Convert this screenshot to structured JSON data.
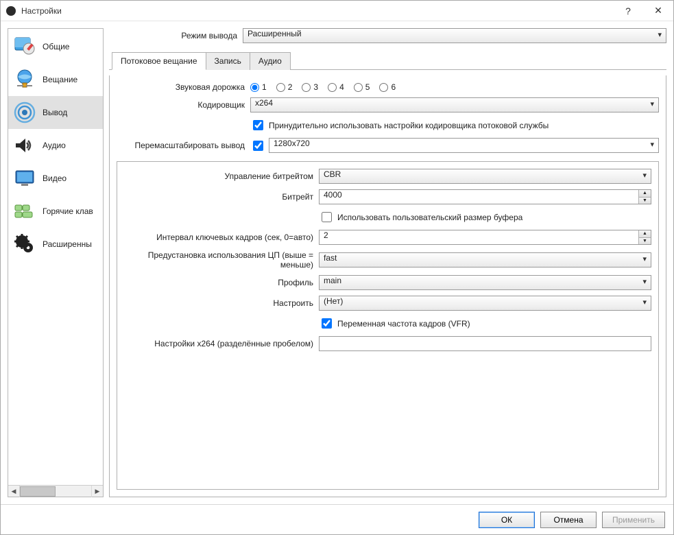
{
  "window": {
    "title": "Настройки",
    "help": "?",
    "close": "✕"
  },
  "sidebar": {
    "items": [
      {
        "label": "Общие",
        "icon": "general"
      },
      {
        "label": "Вещание",
        "icon": "stream"
      },
      {
        "label": "Вывод",
        "icon": "output",
        "selected": true
      },
      {
        "label": "Аудио",
        "icon": "audio"
      },
      {
        "label": "Видео",
        "icon": "video"
      },
      {
        "label": "Горячие клав",
        "icon": "hotkeys"
      },
      {
        "label": "Расширенны",
        "icon": "advanced"
      }
    ]
  },
  "output_mode": {
    "label": "Режим вывода",
    "value": "Расширенный"
  },
  "tabs": [
    {
      "label": "Потоковое вещание",
      "active": true
    },
    {
      "label": "Запись"
    },
    {
      "label": "Аудио"
    }
  ],
  "streaming": {
    "audio_track_label": "Звуковая дорожка",
    "audio_tracks": [
      "1",
      "2",
      "3",
      "4",
      "5",
      "6"
    ],
    "audio_track_selected": "1",
    "encoder_label": "Кодировщик",
    "encoder_value": "x264",
    "enforce_label": "Принудительно использовать настройки кодировщика потоковой службы",
    "enforce_checked": true,
    "rescale_label": "Перемасштабировать вывод",
    "rescale_checked": true,
    "rescale_value": "1280x720"
  },
  "encoder": {
    "rate_control_label": "Управление битрейтом",
    "rate_control_value": "CBR",
    "bitrate_label": "Битрейт",
    "bitrate_value": "4000",
    "custom_buffer_label": "Использовать пользовательский размер буфера",
    "custom_buffer_checked": false,
    "keyint_label": "Интервал ключевых кадров (сек, 0=авто)",
    "keyint_value": "2",
    "preset_label": "Предустановка использования ЦП (выше = меньше)",
    "preset_value": "fast",
    "profile_label": "Профиль",
    "profile_value": "main",
    "tune_label": "Настроить",
    "tune_value": "(Нет)",
    "vfr_label": "Переменная частота кадров (VFR)",
    "vfr_checked": true,
    "x264opts_label": "Настройки х264 (разделённые пробелом)",
    "x264opts_value": ""
  },
  "footer": {
    "ok": "ОК",
    "cancel": "Отмена",
    "apply": "Применить"
  }
}
